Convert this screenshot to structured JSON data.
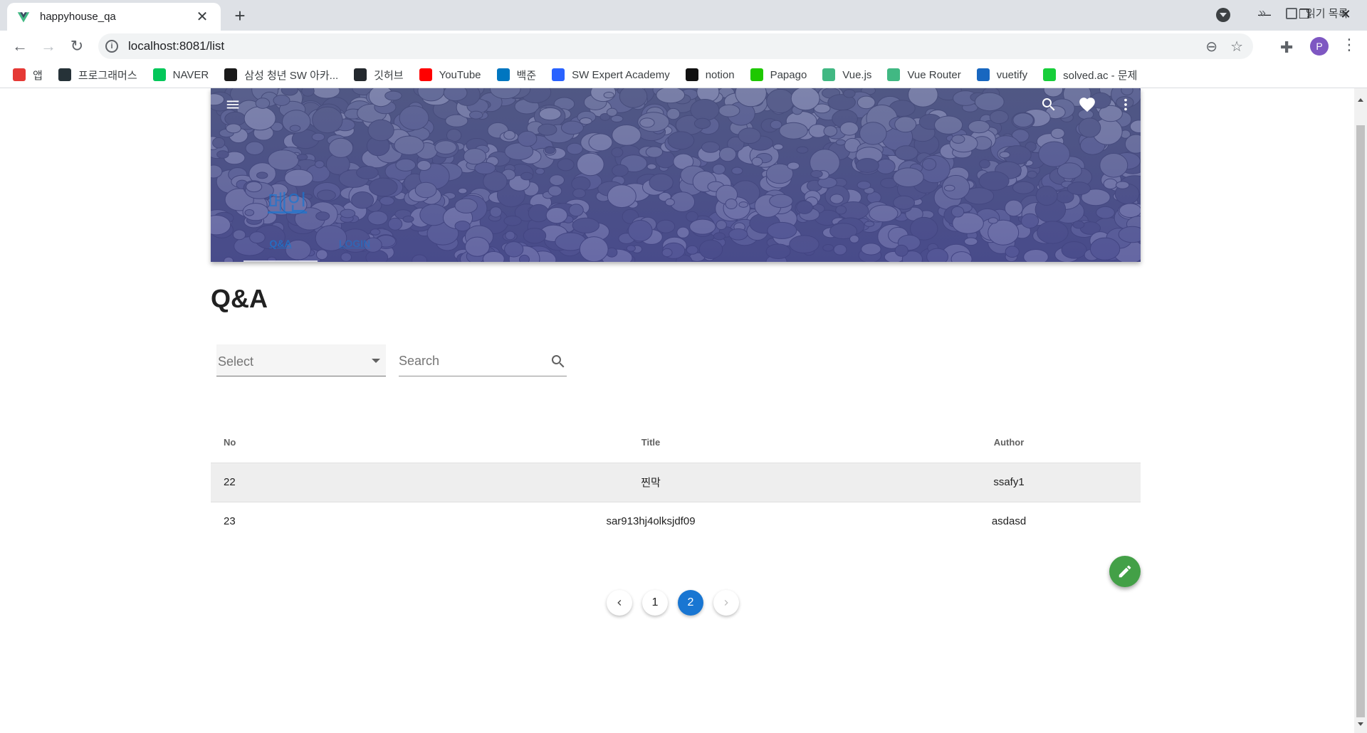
{
  "browser": {
    "tab_title": "happyhouse_qa",
    "url": "localhost:8081/list",
    "bookmarks": [
      {
        "label": "앱",
        "icon": "apps-grid-icon",
        "color": "#e53935"
      },
      {
        "label": "프로그래머스",
        "icon": "programmers-icon",
        "color": "#263238"
      },
      {
        "label": "NAVER",
        "icon": "naver-icon",
        "color": "#03c75a"
      },
      {
        "label": "삼성 청년 SW 아카...",
        "icon": "ssafy-icon",
        "color": "#1a1a1a"
      },
      {
        "label": "깃허브",
        "icon": "github-icon",
        "color": "#24292e"
      },
      {
        "label": "YouTube",
        "icon": "youtube-icon",
        "color": "#ff0000"
      },
      {
        "label": "백준",
        "icon": "baekjoon-icon",
        "color": "#0076c0"
      },
      {
        "label": "SW Expert Academy",
        "icon": "swea-icon",
        "color": "#2962ff"
      },
      {
        "label": "notion",
        "icon": "notion-icon",
        "color": "#111111"
      },
      {
        "label": "Papago",
        "icon": "papago-icon",
        "color": "#1ec800"
      },
      {
        "label": "Vue.js",
        "icon": "vue-icon",
        "color": "#41b883"
      },
      {
        "label": "Vue Router",
        "icon": "vue-icon",
        "color": "#41b883"
      },
      {
        "label": "vuetify",
        "icon": "vuetify-icon",
        "color": "#1867c0"
      },
      {
        "label": "solved.ac - 문제",
        "icon": "solvedac-icon",
        "color": "#17ce3a"
      }
    ],
    "more_bookmarks": "»",
    "reading_list": "읽기 목록",
    "avatar_letter": "P"
  },
  "appbar": {
    "title": "메인",
    "tabs": [
      "Q&A",
      "LOGIN"
    ]
  },
  "page": {
    "title": "Q&A",
    "select_label": "Select",
    "search_placeholder": "Search"
  },
  "table": {
    "headers": {
      "no": "No",
      "title": "Title",
      "author": "Author"
    },
    "rows": [
      {
        "no": "22",
        "title": "찐막",
        "author": "ssafy1"
      },
      {
        "no": "23",
        "title": "sar913hj4olksjdf09",
        "author": "asdasd"
      }
    ]
  },
  "pagination": {
    "pages": [
      "1",
      "2"
    ],
    "current": "2"
  },
  "colors": {
    "primary": "#1976d2",
    "fab": "#43a047"
  }
}
